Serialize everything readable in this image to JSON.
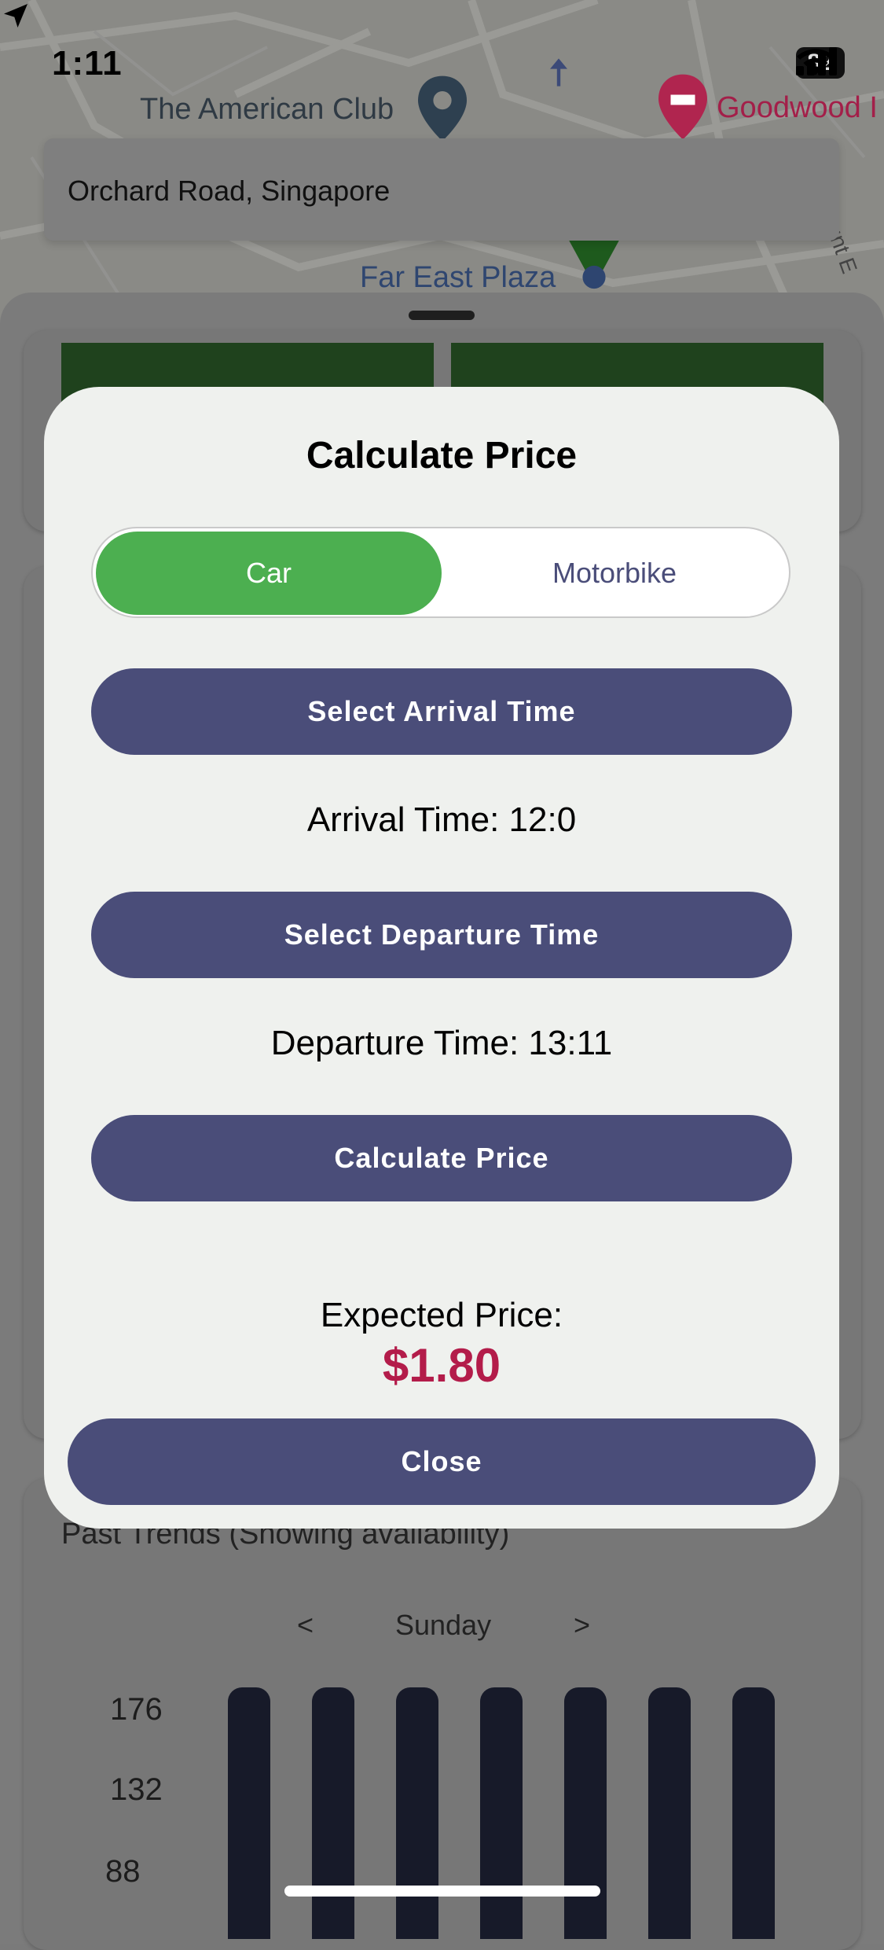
{
  "status_bar": {
    "time": "1:11",
    "battery": "82"
  },
  "map": {
    "labels": {
      "american_club": "The American Club",
      "goodwood": "Goodwood I",
      "far_east_plaza": "Far East Plaza",
      "street_fragment": "unt E"
    },
    "search_value": "Orchard Road, Singapore"
  },
  "background": {
    "trends_title": "Past Trends (Showing availability)",
    "day_prev": "<",
    "day": "Sunday",
    "day_next": ">",
    "y_ticks": [
      "176",
      "132",
      "88"
    ]
  },
  "modal": {
    "title": "Calculate Price",
    "vehicle_options": [
      "Car",
      "Motorbike"
    ],
    "selected_vehicle": "Car",
    "arrival_button": "Select Arrival Time",
    "arrival_text": "Arrival Time: 12:0",
    "departure_button": "Select Departure Time",
    "departure_text": "Departure Time: 13:11",
    "calculate_button": "Calculate Price",
    "expected_label": "Expected Price:",
    "expected_value": "$1.80",
    "close_button": "Close"
  },
  "colors": {
    "accent_green": "#4caf50",
    "button_indigo": "#4a4d79",
    "price_red": "#b31c4a"
  }
}
